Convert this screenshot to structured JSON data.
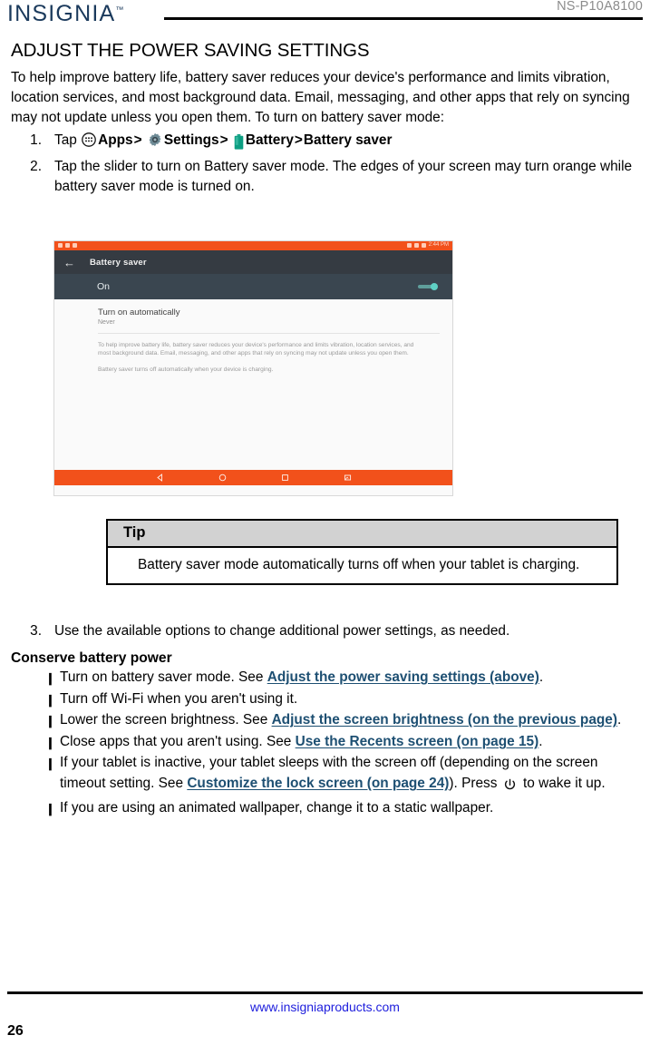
{
  "header": {
    "brand": "INSIGNIA",
    "brand_tm": "™",
    "model_number": "NS-P10A8100",
    "brand_color": "#1b3a5c"
  },
  "section": {
    "title": "ADJUST THE POWER SAVING SETTINGS",
    "intro": "To help improve battery life, battery saver reduces your device's performance and limits vibration, location services, and most background data. Email, messaging, and other apps that rely on syncing may not update unless you open them. To turn on battery saver mode:"
  },
  "steps": [
    {
      "number": "1.",
      "tap_label": "Tap",
      "apps_icon": "apps-grid-icon",
      "apps_label": "Apps",
      "sep1": ">",
      "settings_icon": "gear-icon",
      "settings_label": "Settings",
      "sep2": ">",
      "battery_icon": "battery-icon",
      "battery_label": "Battery",
      "sep3": ">",
      "battery_saver_label": "Battery saver"
    },
    {
      "number": "2.",
      "text": "Tap the slider to turn on Battery saver mode. The edges of your screen may turn orange while battery saver mode is turned on."
    },
    {
      "number": "3.",
      "text": "Use the available options to change additional power settings, as needed."
    }
  ],
  "screenshot": {
    "status_bar": {
      "time": "2:44 PM",
      "background": "#f2511b",
      "left_icons": [
        "sim-icon",
        "download-icon",
        "wifi-icon"
      ],
      "right_icons": [
        "bluetooth-icon",
        "wifi-icon",
        "battery-icon"
      ]
    },
    "app_bar": {
      "back_icon": "back-arrow-icon",
      "title": "Battery saver",
      "background": "#353b42"
    },
    "switch_row": {
      "label": "On",
      "toggle_state": "on",
      "toggle_color": "#5fd0c4",
      "background": "#3a4650"
    },
    "list_item": {
      "title": "Turn on automatically",
      "subtitle": "Never"
    },
    "description_1": "To help improve battery life, battery saver reduces your device's performance and limits vibration, location services, and most background data. Email, messaging, and other apps that rely on syncing may not update unless you open them.",
    "description_2": "Battery saver turns off automatically when your device is charging.",
    "nav_bar": {
      "background": "#f2511b",
      "buttons": [
        "back-triangle-icon",
        "home-circle-icon",
        "recents-square-icon",
        "screenshot-icon"
      ]
    }
  },
  "tip": {
    "header": "Tip",
    "body": "Battery saver mode automatically turns off when your tablet is charging."
  },
  "conserve": {
    "heading": "Conserve battery power",
    "bullet_mark": "❙",
    "items": [
      {
        "pre": "Turn on battery saver mode. See ",
        "link": "Adjust the power saving settings (above)",
        "post": "."
      },
      {
        "pre": "Turn off Wi-Fi when you aren't using it.",
        "link": "",
        "post": ""
      },
      {
        "pre": "Lower the screen brightness. See ",
        "link": "Adjust the screen brightness (on the previous page)",
        "post": "."
      },
      {
        "pre": "Close apps that you aren't using. See ",
        "link": "Use the Recents screen (on page 15)",
        "post": "."
      },
      {
        "pre": "If your tablet is inactive, your tablet sleeps with the screen off (depending on the screen timeout setting. See ",
        "link": "Customize the lock screen (on page 24)",
        "post": "). Press ",
        "power_icon": "power-icon",
        "post2": " to wake it up."
      },
      {
        "pre": "If you are using an animated wallpaper, change it to a static wallpaper.",
        "link": "",
        "post": ""
      }
    ]
  },
  "footer": {
    "url": "www.insigniaproducts.com",
    "page_number": "26",
    "url_color": "#2020dd"
  }
}
